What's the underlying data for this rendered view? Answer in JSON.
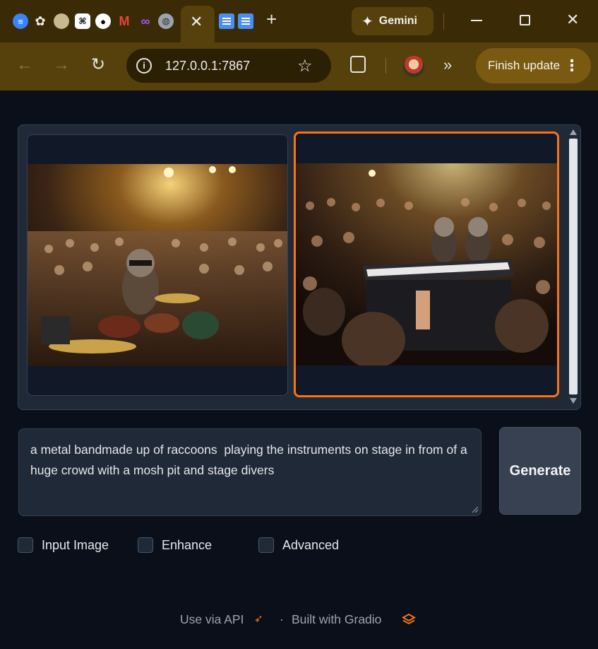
{
  "browser": {
    "favicons": [
      "tab-icon-1",
      "openai-icon",
      "tab-icon-3",
      "tab-icon-4",
      "github-icon",
      "gmail-icon",
      "tab-icon-7",
      "globe-icon"
    ],
    "active_tab_close": "✕",
    "new_tab": "+",
    "gemini_label": "Gemini",
    "url": "127.0.0.1:7867",
    "finish_update": "Finish update"
  },
  "gallery": {
    "images": [
      {
        "name": "raccoon-drummer-image",
        "selected": false
      },
      {
        "name": "raccoon-keyboardists-image",
        "selected": true
      }
    ]
  },
  "prompt": {
    "value": "a metal bandmade up of raccoons  playing the instruments on stage in from of a huge crowd with a mosh pit and stage divers"
  },
  "generate_label": "Generate",
  "options": {
    "input_image": "Input Image",
    "enhance": "Enhance",
    "advanced": "Advanced"
  },
  "footer": {
    "api": "Use via API",
    "dot": "·",
    "built": "Built with Gradio"
  },
  "colors": {
    "accent": "#f97316",
    "page_bg": "#0b0f19",
    "panel_bg": "#1f2937"
  }
}
